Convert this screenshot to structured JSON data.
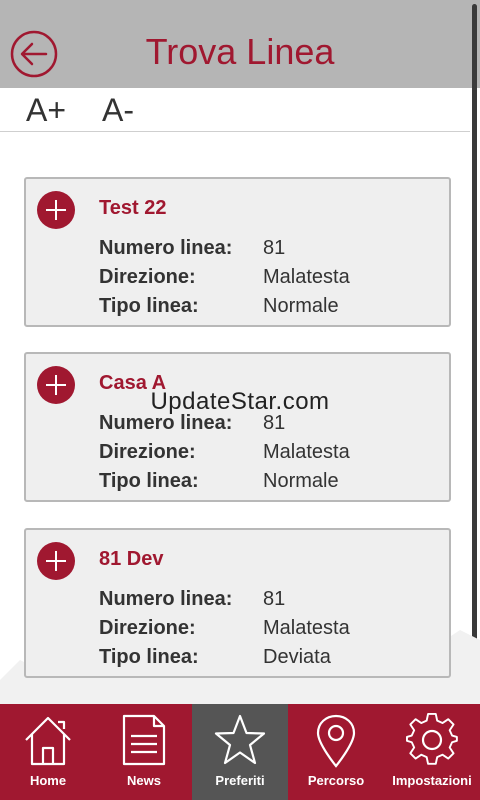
{
  "header": {
    "title": "Trova Linea"
  },
  "font_controls": {
    "increase": "A+",
    "decrease": "A-"
  },
  "watermark": "UpdateStar.com",
  "cards": [
    {
      "name": "Test 22",
      "labels": [
        "Numero linea:",
        "Direzione:",
        "Tipo linea:"
      ],
      "values": [
        "81",
        "Malatesta",
        "Normale"
      ]
    },
    {
      "name": "Casa A",
      "labels": [
        "Numero linea:",
        "Direzione:",
        "Tipo linea:"
      ],
      "values": [
        "81",
        "Malatesta",
        "Normale"
      ]
    },
    {
      "name": "81 Dev",
      "labels": [
        "Numero linea:",
        "Direzione:",
        "Tipo linea:"
      ],
      "values": [
        "81",
        "Malatesta",
        "Deviata"
      ]
    }
  ],
  "tabs": [
    {
      "label": "Home",
      "icon": "home-icon"
    },
    {
      "label": "News",
      "icon": "news-icon"
    },
    {
      "label": "Preferiti",
      "icon": "star-icon",
      "active": true
    },
    {
      "label": "Percorso",
      "icon": "location-pin-icon"
    },
    {
      "label": "Impostazioni",
      "icon": "gear-icon"
    }
  ],
  "colors": {
    "brand": "#a01830",
    "header_bg": "#b5b5b5",
    "active_tab": "#555555",
    "card_bg": "#efefef"
  }
}
